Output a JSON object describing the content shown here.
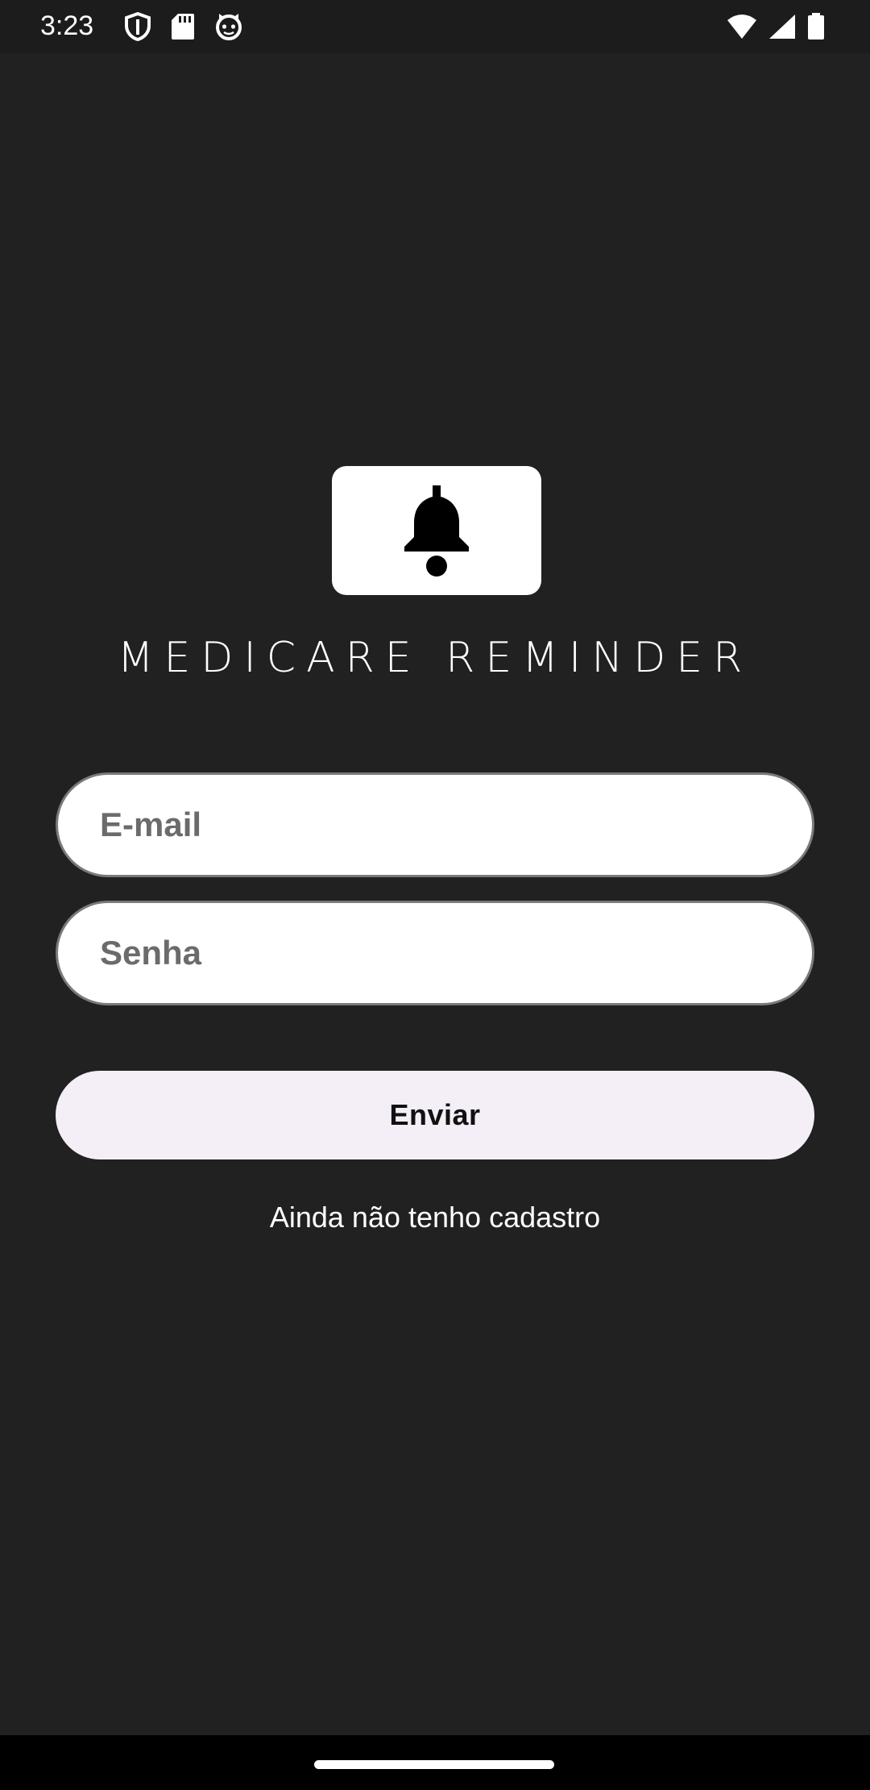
{
  "status_bar": {
    "time": "3:23",
    "left_icons": [
      "shield-icon",
      "sd-card-icon",
      "cat-face-icon"
    ],
    "right_icons": [
      "wifi-icon",
      "signal-icon",
      "battery-icon"
    ]
  },
  "logo": {
    "icon": "bell-icon",
    "title": "MEDICARE REMINDER"
  },
  "login_form": {
    "email_placeholder": "E-mail",
    "password_placeholder": "Senha",
    "submit_label": "Enviar",
    "register_link": "Ainda não tenho cadastro"
  },
  "colors": {
    "background": "#212121",
    "status_bar": "#1c1c1c",
    "button_bg": "#f4eff6",
    "field_bg": "#ffffff",
    "text_light": "#ffffff"
  }
}
